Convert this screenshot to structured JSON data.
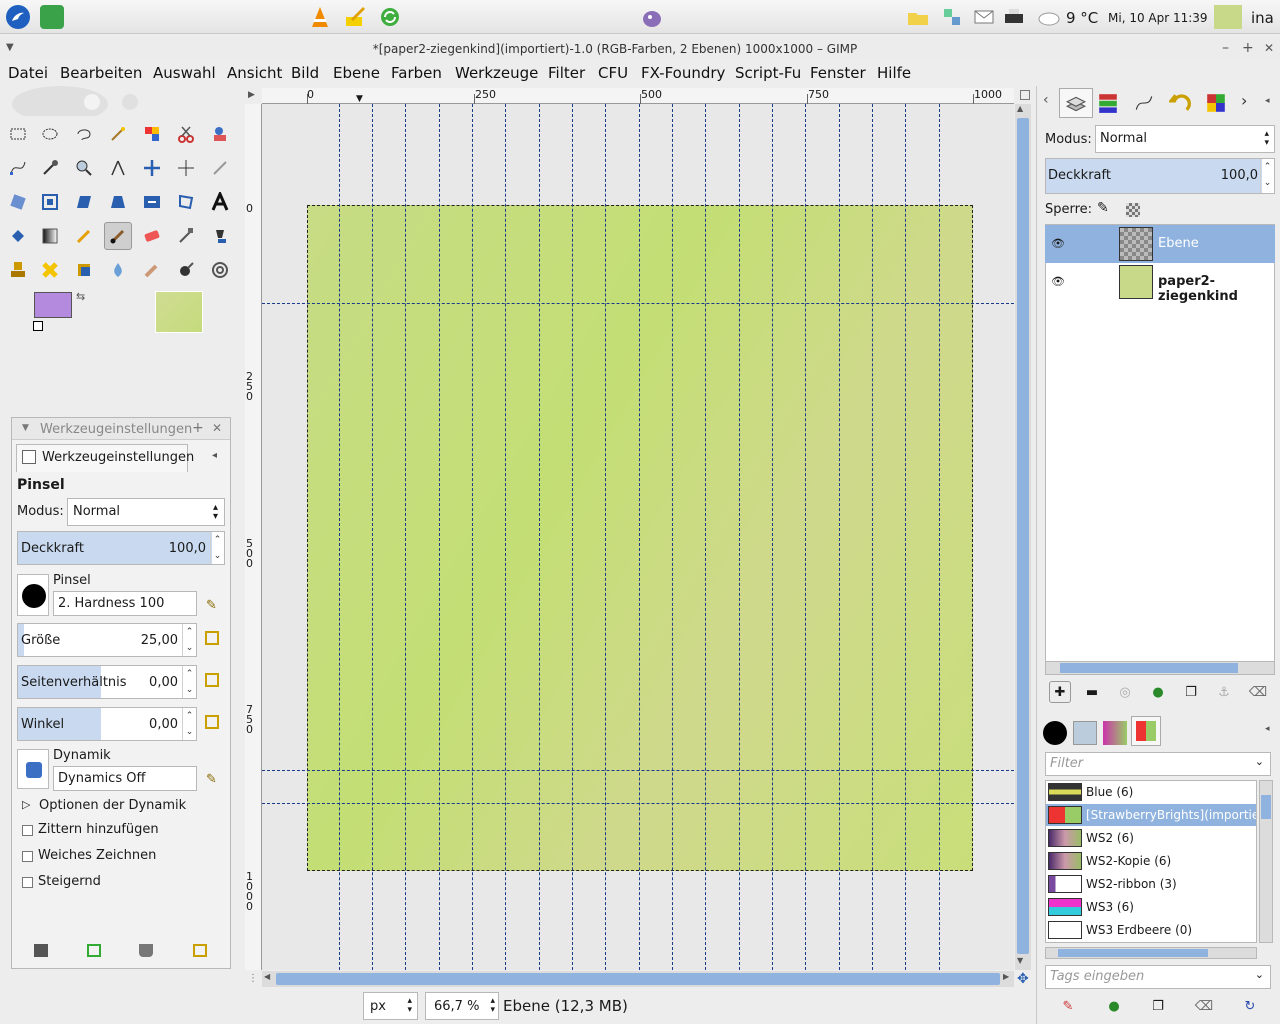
{
  "panel": {
    "weather": "9 °C",
    "clock": "Mi, 10 Apr  11:39",
    "user": "ina"
  },
  "window": {
    "title": "*[paper2-ziegenkind](importiert)-1.0 (RGB-Farben, 2 Ebenen) 1000x1000 – GIMP",
    "min": "–",
    "max": "+",
    "close": "✕"
  },
  "menu": [
    "Datei",
    "Bearbeiten",
    "Auswahl",
    "Ansicht",
    "Bild",
    "Ebene",
    "Farben",
    "Werkzeuge",
    "Filter",
    "CFU",
    "FX-Foundry",
    "Script-Fu",
    "Fenster",
    "Hilfe"
  ],
  "toolopts": {
    "window_title": "Werkzeugeinstellungen",
    "tab_label": "Werkzeugeinstellungen",
    "tool_name": "Pinsel",
    "mode_label": "Modus:",
    "mode_value": "Normal",
    "opacity_label": "Deckkraft",
    "opacity_value": "100,0",
    "opacity_fraction": 1.0,
    "brush_label": "Pinsel",
    "brush_value": "2. Hardness 100",
    "size_label": "Größe",
    "size_value": "25,00",
    "ratio_label": "Seitenverhältnis",
    "ratio_value": "0,00",
    "angle_label": "Winkel",
    "angle_value": "0,00",
    "dynamics_label": "Dynamik",
    "dynamics_value": "Dynamics Off",
    "dyn_options": "Optionen der Dynamik",
    "jitter": "Zittern hinzufügen",
    "smooth": "Weiches Zeichnen",
    "incremental": "Steigernd"
  },
  "rulers": {
    "h_ticks": [
      "0",
      "250",
      "500",
      "750",
      "1000"
    ],
    "v_ticks": [
      "0",
      "250",
      "500",
      "750",
      "1000"
    ]
  },
  "status": {
    "unit": "px",
    "zoom": "66,7 %",
    "layer_info": "Ebene (12,3 MB)"
  },
  "layers": {
    "mode_label": "Modus:",
    "mode_value": "Normal",
    "opacity_label": "Deckkraft",
    "opacity_value": "100,0",
    "lock_label": "Sperre:",
    "items": [
      {
        "name": "Ebene"
      },
      {
        "name": "paper2-ziegenkind"
      }
    ]
  },
  "palettes": {
    "filter_placeholder": "Filter",
    "tags_placeholder": "Tags eingeben",
    "items": [
      {
        "name": "Blue (6)"
      },
      {
        "name": "[StrawberryBrights](importie"
      },
      {
        "name": "WS2 (6)"
      },
      {
        "name": "WS2-Kopie (6)"
      },
      {
        "name": "WS2-ribbon (3)"
      },
      {
        "name": "WS3 (6)"
      },
      {
        "name": "WS3 Erdbeere (0)"
      }
    ]
  },
  "colors": {
    "foreground": "#b48adf",
    "background": "#a1bf75",
    "pattern": "#c9d98a",
    "accent": "#c9daf0"
  }
}
